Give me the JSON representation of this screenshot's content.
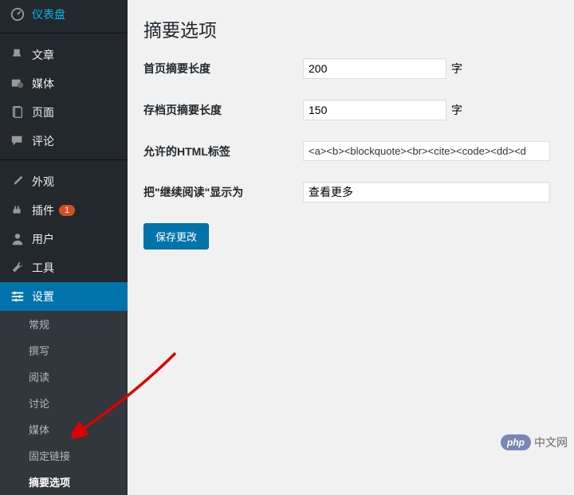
{
  "sidebar": {
    "dashboard": "仪表盘",
    "posts": "文章",
    "media": "媒体",
    "pages": "页面",
    "comments": "评论",
    "appearance": "外观",
    "plugins": "插件",
    "plugins_badge": "1",
    "users": "用户",
    "tools": "工具",
    "settings": "设置",
    "submenu": {
      "general": "常规",
      "writing": "撰写",
      "reading": "阅读",
      "discussion": "讨论",
      "media": "媒体",
      "permalinks": "固定链接",
      "excerpt": "摘要选项"
    }
  },
  "page": {
    "title": "摘要选项",
    "fields": {
      "home_excerpt_label": "首页摘要长度",
      "home_excerpt_value": "200",
      "home_excerpt_suffix": "字",
      "archive_excerpt_label": "存档页摘要长度",
      "archive_excerpt_value": "150",
      "archive_excerpt_suffix": "字",
      "allowed_html_label": "允许的HTML标签",
      "allowed_html_value": "<a><b><blockquote><br><cite><code><dd><d",
      "readmore_label": "把\"继续阅读\"显示为",
      "readmore_value": "查看更多"
    },
    "save_button": "保存更改"
  },
  "footer": {
    "php_logo": "php",
    "php_text": "中文网"
  }
}
